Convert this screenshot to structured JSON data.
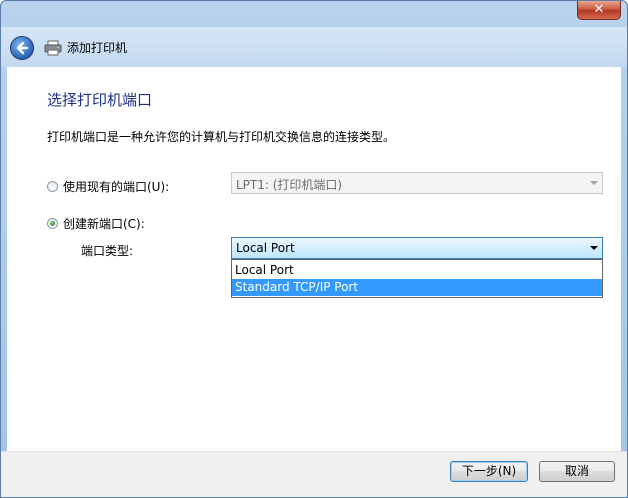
{
  "window": {
    "close_symbol": "✕"
  },
  "nav": {
    "title": "添加打印机",
    "back_icon": "back-arrow-icon",
    "printer_icon": "printer-icon"
  },
  "content": {
    "heading": "选择打印机端口",
    "description": "打印机端口是一种允许您的计算机与打印机交换信息的连接类型。",
    "existing_port_label": "使用现有的端口(U):",
    "existing_port_value": "LPT1: (打印机端口)",
    "new_port_label": "创建新端口(C):",
    "port_type_label": "端口类型:",
    "port_type_value": "Local Port",
    "port_type_options": [
      "Local Port",
      "Standard TCP/IP Port"
    ]
  },
  "footer": {
    "next_label": "下一步(N)",
    "cancel_label": "取消"
  }
}
